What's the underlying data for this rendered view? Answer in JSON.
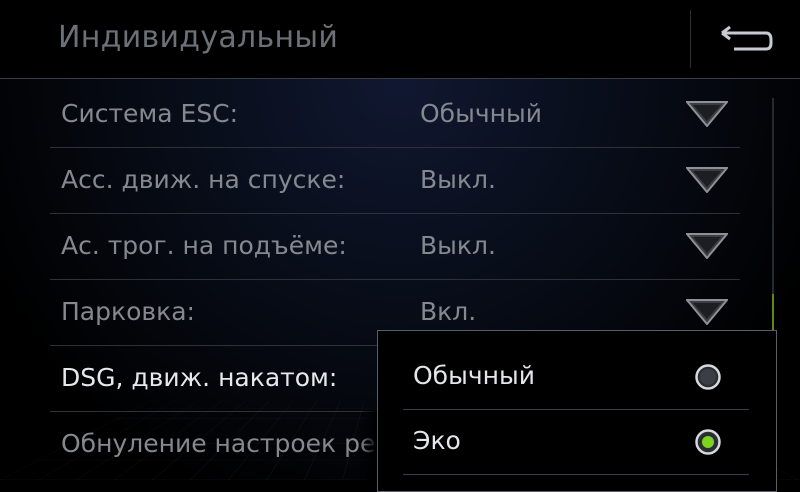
{
  "header": {
    "title": "Индивидуальный",
    "back_icon": "back-arrow-icon"
  },
  "settings": [
    {
      "label": "Система ESC:",
      "value": "Обычный"
    },
    {
      "label": "Асс. движ. на спуске:",
      "value": "Выкл."
    },
    {
      "label": "Ас. трог. на подъёме:",
      "value": "Выкл."
    },
    {
      "label": "Парковка:",
      "value": "Вкл."
    },
    {
      "label": "DSG, движ. накатом:",
      "value": ""
    },
    {
      "label": "Обнуление настроек реж",
      "value": ""
    }
  ],
  "popup": {
    "options": [
      {
        "label": "Обычный",
        "selected": false
      },
      {
        "label": "Эко",
        "selected": true
      }
    ]
  },
  "colors": {
    "accent": "#7ed321",
    "text_dim": "#85898f",
    "text_active": "#e6e8ec",
    "scroll_thumb": "#5a8a1e"
  }
}
